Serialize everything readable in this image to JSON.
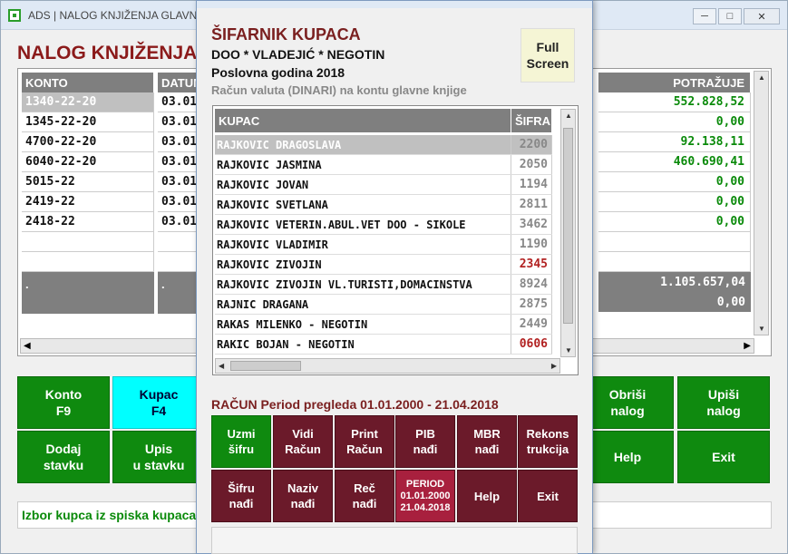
{
  "main": {
    "title_bar": "ADS | NALOG KNJIŽENJA GLAVNE K",
    "heading": "NALOG KNJIŽENJA",
    "grid": {
      "col_konto": "KONTO",
      "col_datum": "DATUM",
      "col_potrazuje": "POTRAŽUJE",
      "rows": [
        {
          "konto": "1340-22-20",
          "datum": "03.01",
          "potrazuje": "552.828,52"
        },
        {
          "konto": "1345-22-20",
          "datum": "03.01",
          "potrazuje": "0,00"
        },
        {
          "konto": "4700-22-20",
          "datum": "03.01",
          "potrazuje": "92.138,11"
        },
        {
          "konto": "6040-22-20",
          "datum": "03.01",
          "potrazuje": "460.690,41"
        },
        {
          "konto": "5015-22",
          "datum": "03.01",
          "potrazuje": "0,00"
        },
        {
          "konto": "2419-22",
          "datum": "03.01",
          "potrazuje": "0,00"
        },
        {
          "konto": "2418-22",
          "datum": "03.01",
          "potrazuje": "0,00"
        }
      ],
      "total_dot": ".",
      "total_1": "1.105.657,04",
      "total_2": "0,00"
    },
    "buttons": {
      "konto": "Konto\nF9",
      "kupac": "Kupac\nF4",
      "dodaj": "Dodaj\nstavku",
      "upis": "Upis\nu stavku",
      "obrisi": "Obriši\nnalog",
      "upisi": "Upiši\nnalog",
      "help": "Help",
      "exit": "Exit"
    },
    "status": "Izbor kupca iz spiska kupaca ["
  },
  "dialog": {
    "title": "ŠIFARNIK KUPACA",
    "company": "DOO * VLADEJIĆ * NEGOTIN",
    "year": "Poslovna godina 2018",
    "valuta": "Račun valuta  (DINARI)  na kontu glavne knjige",
    "fullscreen": "Full\nScreen",
    "list": {
      "col_kupac": "KUPAC",
      "col_sifra": "ŠIFRA",
      "rows": [
        {
          "name": "RAJKOVIC DRAGOSLAVA",
          "code": "2200"
        },
        {
          "name": "RAJKOVIC JASMINA",
          "code": "2050"
        },
        {
          "name": "RAJKOVIC JOVAN",
          "code": "1194"
        },
        {
          "name": "RAJKOVIC SVETLANA",
          "code": "2811"
        },
        {
          "name": "RAJKOVIC VETERIN.ABUL.VET DOO - SIKOLE",
          "code": "3462"
        },
        {
          "name": "RAJKOVIC VLADIMIR",
          "code": "1190"
        },
        {
          "name": "RAJKOVIC ZIVOJIN",
          "code": "2345"
        },
        {
          "name": "RAJKOVIC ZIVOJIN VL.TURISTI,DOMACINSTVA",
          "code": "8924"
        },
        {
          "name": "RAJNIC DRAGANA",
          "code": "2875"
        },
        {
          "name": "RAKAS MILENKO - NEGOTIN",
          "code": "2449"
        },
        {
          "name": "RAKIC BOJAN - NEGOTIN",
          "code": "0606"
        }
      ]
    },
    "period_line": "RAČUN Period pregleda  01.01.2000 - 21.04.2018",
    "buttons": {
      "uzmi": "Uzmi\nšifru",
      "vidi": "Vidi\nRačun",
      "print": "Print\nRačun",
      "pib": "PIB\nnađi",
      "mbr": "MBR\nnađi",
      "rekon": "Rekons\ntrukcija",
      "sifru": "Šifru\nnađi",
      "naziv": "Naziv\nnađi",
      "rec": "Reč\nnađi",
      "period": "PERIOD\n01.01.2000\n21.04.2018",
      "help": "Help",
      "exit": "Exit"
    }
  }
}
